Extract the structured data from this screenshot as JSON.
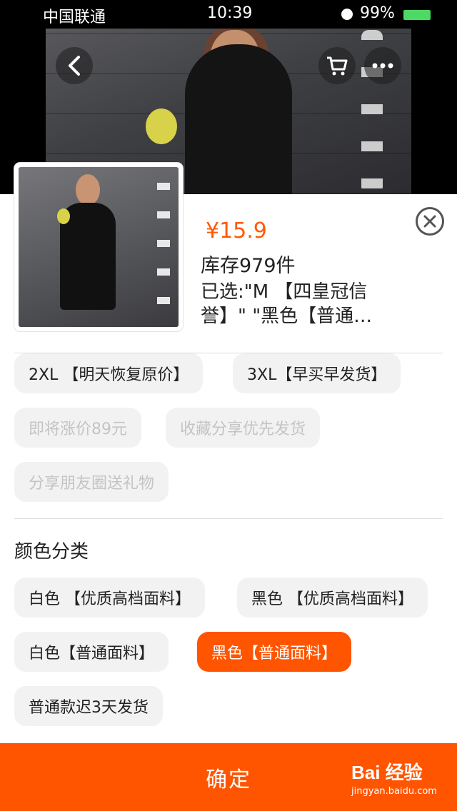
{
  "status_bar": {
    "carrier": "中国联通",
    "time": "10:39",
    "battery": "99%",
    "battery_color": "#4cd964"
  },
  "hero": {
    "back_icon": "chevron-left-icon",
    "cart_icon": "cart-icon",
    "more_icon": "more-icon"
  },
  "product": {
    "price": "¥15.9",
    "stock": "库存979件",
    "selected": "已选:\"M 【四皇冠信誉】\" \"黑色【普通…"
  },
  "size_options": [
    {
      "label": "2XL 【明天恢复原价】",
      "state": "normal"
    },
    {
      "label": "3XL【早买早发货】",
      "state": "normal"
    },
    {
      "label": "即将涨价89元",
      "state": "disabled"
    },
    {
      "label": "收藏分享优先发货",
      "state": "disabled"
    },
    {
      "label": "分享朋友圈送礼物",
      "state": "disabled"
    }
  ],
  "color_section": {
    "title": "颜色分类",
    "options": [
      {
        "label": "白色 【优质高档面料】",
        "state": "normal"
      },
      {
        "label": "黑色 【优质高档面料】",
        "state": "normal"
      },
      {
        "label": "白色【普通面料】",
        "state": "normal"
      },
      {
        "label": "黑色【普通面料】",
        "state": "selected"
      },
      {
        "label": "普通款迟3天发货",
        "state": "normal"
      }
    ]
  },
  "confirm_label": "确定",
  "watermark": {
    "brand": "Bai 经验",
    "url": "jingyan.baidu.com"
  },
  "colors": {
    "accent": "#ff5500",
    "price": "#ff5a00"
  }
}
